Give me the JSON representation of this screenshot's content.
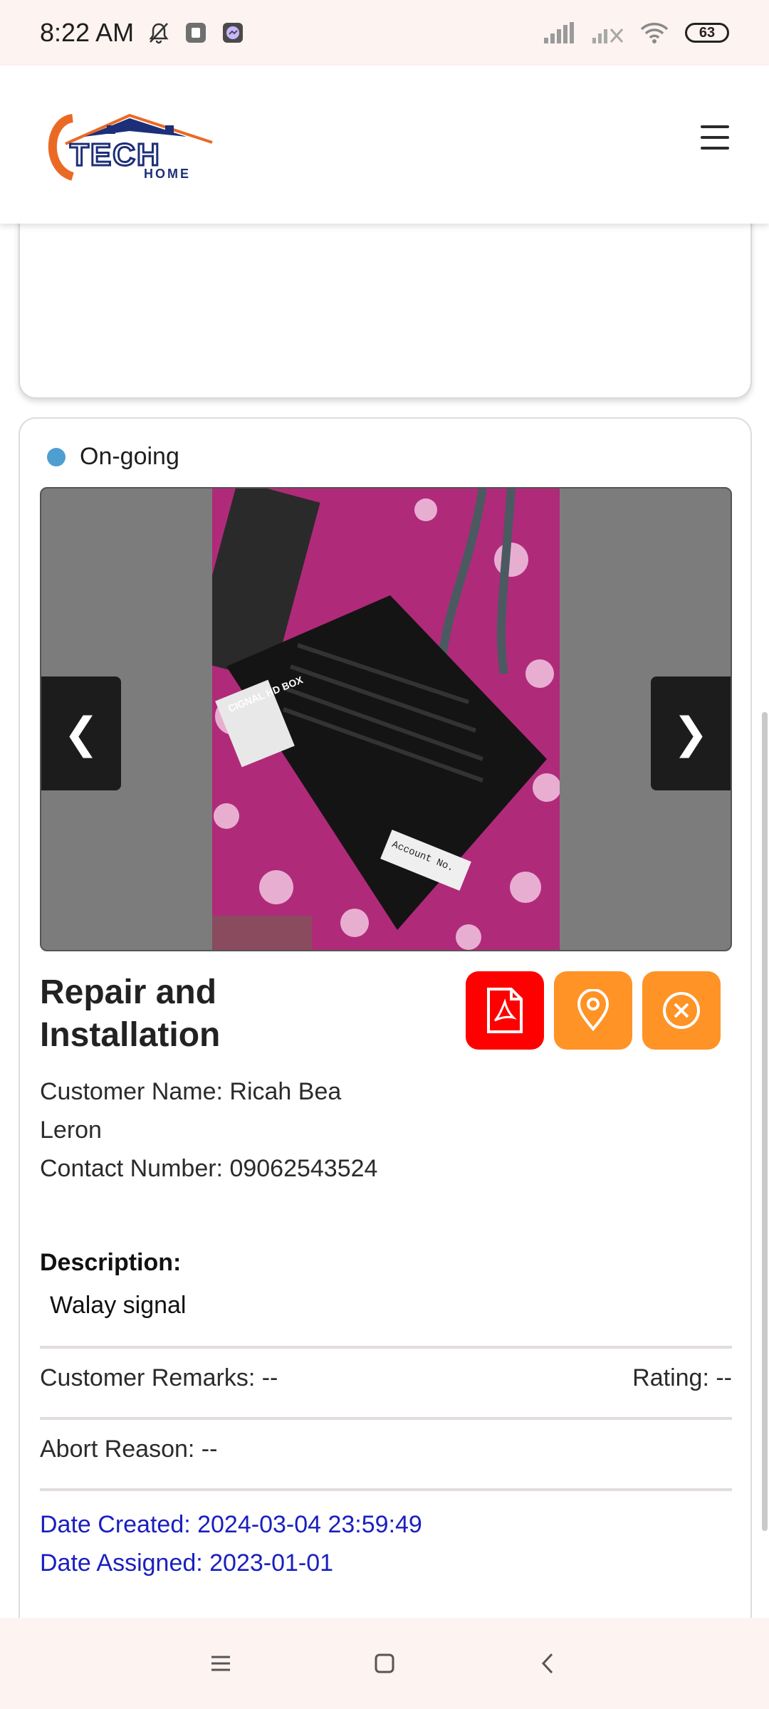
{
  "status_bar": {
    "time": "8:22 AM",
    "battery": "63",
    "icons": [
      "mute-icon",
      "notification-app-icon",
      "messenger-icon",
      "signal-icon",
      "signal-x-icon",
      "wifi-icon",
      "battery-icon"
    ]
  },
  "header": {
    "logo_text": "TECH HOME",
    "menu_icon": "hamburger-icon"
  },
  "job": {
    "status": "On-going",
    "status_color": "#4f9ed1",
    "title": "Repair and Installation",
    "customer_name": "Customer Name: Ricah Bea Leron",
    "contact_number": "Contact Number: 09062543524",
    "description_label": "Description:",
    "description": "Walay signal",
    "customer_remarks": "Customer Remarks: --",
    "rating": "Rating: --",
    "abort_reason": "Abort Reason: --",
    "date_created": "Date Created: 2024-03-04 23:59:49",
    "date_assigned": "Date Assigned: 2023-01-01",
    "carousel": {
      "prev": "❮",
      "next": "❯",
      "image_label": "CIGNAL HD BOX",
      "image_text": "Account No."
    },
    "actions": [
      {
        "name": "pdf",
        "icon": "pdf-icon",
        "color": "#ff0000"
      },
      {
        "name": "location",
        "icon": "map-pin-icon",
        "color": "#ff9326"
      },
      {
        "name": "cancel",
        "icon": "close-circle-icon",
        "color": "#ff9326"
      }
    ]
  },
  "nav": {
    "icons": [
      "recent-apps-icon",
      "home-icon",
      "back-icon"
    ]
  }
}
